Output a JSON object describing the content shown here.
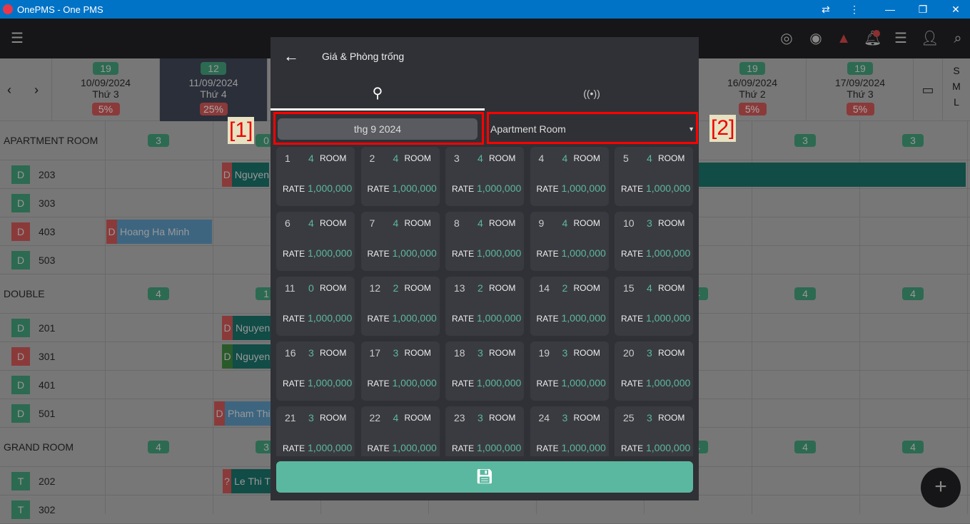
{
  "window": {
    "title": "OnePMS - One PMS",
    "controls": [
      "translate-icon",
      "more-icon",
      "minimize",
      "restore",
      "close"
    ]
  },
  "appbar": {
    "icons": [
      "radar-icon",
      "eye-icon",
      "warning-icon",
      "bell-icon",
      "list-icon",
      "add-user-icon",
      "search-icon"
    ]
  },
  "dates": [
    {
      "count": "19",
      "date": "10/09/2024",
      "day": "Thứ 3",
      "occ": "5%"
    },
    {
      "count": "12",
      "date": "11/09/2024",
      "day": "Thứ 4",
      "occ": "25%",
      "selected": true
    },
    {},
    {},
    {},
    {},
    {
      "count": "19",
      "date": "16/09/2024",
      "day": "Thứ 2",
      "occ": "5%"
    },
    {
      "count": "19",
      "date": "17/09/2024",
      "day": "Thứ 3",
      "occ": "5%"
    }
  ],
  "size_options": [
    "S",
    "M",
    "L"
  ],
  "groups": [
    {
      "name": "APARTMENT ROOM",
      "counts": [
        "3",
        "0",
        null,
        null,
        null,
        null,
        "3",
        "3"
      ],
      "rooms": [
        {
          "tag": "D",
          "num": "203",
          "status": "clean"
        },
        {
          "tag": "D",
          "num": "303",
          "status": "clean"
        },
        {
          "tag": "D",
          "num": "403",
          "status": "dirty"
        },
        {
          "tag": "D",
          "num": "503",
          "status": "clean"
        }
      ]
    },
    {
      "name": "DOUBLE",
      "counts": [
        "4",
        "1",
        null,
        null,
        null,
        "4",
        "4",
        "4"
      ],
      "rooms": [
        {
          "tag": "D",
          "num": "201",
          "status": "clean"
        },
        {
          "tag": "D",
          "num": "301",
          "status": "dirty"
        },
        {
          "tag": "D",
          "num": "401",
          "status": "clean"
        },
        {
          "tag": "D",
          "num": "501",
          "status": "clean"
        }
      ]
    },
    {
      "name": "GRAND ROOM",
      "counts": [
        "4",
        "3",
        null,
        null,
        null,
        "4",
        "4",
        "4"
      ],
      "rooms": [
        {
          "tag": "T",
          "num": "202",
          "status": "clean"
        },
        {
          "tag": "T",
          "num": "302",
          "status": "clean"
        }
      ]
    }
  ],
  "bookings": [
    {
      "tag": "D",
      "name": "Nguyen",
      "room": "203"
    },
    {
      "tag": "D",
      "name": "Hoang Ha Minh",
      "room": "403"
    },
    {
      "tag": "D",
      "name": "Nguyen",
      "room": "201"
    },
    {
      "tag": "D",
      "name": "Nguyen",
      "room": "301"
    },
    {
      "tag": "D",
      "name": "Pham Thi",
      "room": "501"
    },
    {
      "tag": "?",
      "name": "Le Thi T",
      "room": "202"
    }
  ],
  "modal": {
    "title": "Giá & Phòng trống",
    "tabs": [
      {
        "icon": "umbrella-icon",
        "active": true
      },
      {
        "icon": "broadcast-icon",
        "active": false
      }
    ],
    "month": "thg 9 2024",
    "room_type": "Apartment Room",
    "room_label": "ROOM",
    "rate_label": "RATE",
    "days": [
      {
        "d": "1",
        "c": "4",
        "r": "1,000,000"
      },
      {
        "d": "2",
        "c": "4",
        "r": "1,000,000"
      },
      {
        "d": "3",
        "c": "4",
        "r": "1,000,000"
      },
      {
        "d": "4",
        "c": "4",
        "r": "1,000,000"
      },
      {
        "d": "5",
        "c": "4",
        "r": "1,000,000"
      },
      {
        "d": "6",
        "c": "4",
        "r": "1,000,000"
      },
      {
        "d": "7",
        "c": "4",
        "r": "1,000,000"
      },
      {
        "d": "8",
        "c": "4",
        "r": "1,000,000"
      },
      {
        "d": "9",
        "c": "4",
        "r": "1,000,000"
      },
      {
        "d": "10",
        "c": "3",
        "r": "1,000,000"
      },
      {
        "d": "11",
        "c": "0",
        "r": "1,000,000"
      },
      {
        "d": "12",
        "c": "2",
        "r": "1,000,000"
      },
      {
        "d": "13",
        "c": "2",
        "r": "1,000,000"
      },
      {
        "d": "14",
        "c": "2",
        "r": "1,000,000"
      },
      {
        "d": "15",
        "c": "4",
        "r": "1,000,000"
      },
      {
        "d": "16",
        "c": "3",
        "r": "1,000,000"
      },
      {
        "d": "17",
        "c": "3",
        "r": "1,000,000"
      },
      {
        "d": "18",
        "c": "3",
        "r": "1,000,000"
      },
      {
        "d": "19",
        "c": "3",
        "r": "1,000,000"
      },
      {
        "d": "20",
        "c": "3",
        "r": "1,000,000"
      },
      {
        "d": "21",
        "c": "3",
        "r": "1,000,000"
      },
      {
        "d": "22",
        "c": "4",
        "r": "1,000,000"
      },
      {
        "d": "23",
        "c": "3",
        "r": "1,000,000"
      },
      {
        "d": "24",
        "c": "3",
        "r": "1,000,000"
      },
      {
        "d": "25",
        "c": "3",
        "r": "1,000,000"
      }
    ],
    "save_icon": "save-icon"
  },
  "annotations": [
    "[1]",
    "[2]"
  ],
  "colors": {
    "accent": "#5bb8a0",
    "titlebar": "#0173c7",
    "clean": "#2d6a52",
    "dirty": "#8b3a3a"
  }
}
